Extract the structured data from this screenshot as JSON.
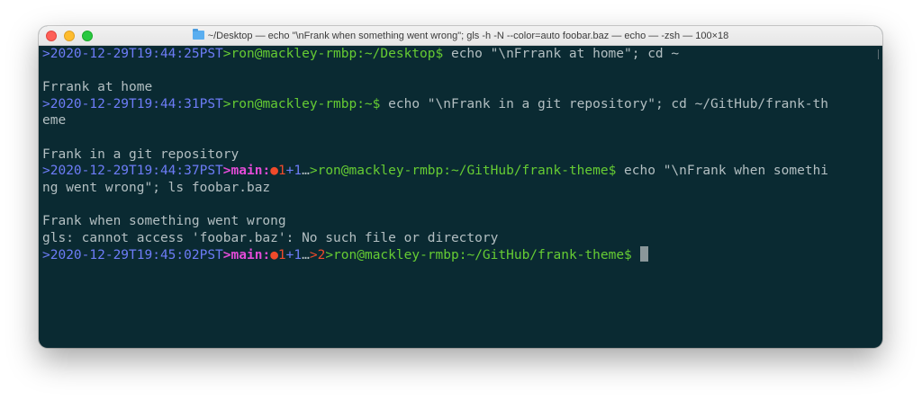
{
  "window": {
    "title": "~/Desktop — echo \"\\nFrank when something went wrong\"; gls -h -N --color=auto foobar.baz — echo — -zsh — 100×18"
  },
  "terminal": {
    "lines": [
      {
        "date": ">2020-12-29T19:44:25PST",
        "userhost": ">ron@mackley-rmbp:~/Desktop$",
        "command": " echo \"\\nFrrank at home\"; cd ~"
      },
      {
        "text": ""
      },
      {
        "text": "Frrank at home"
      },
      {
        "date": ">2020-12-29T19:44:31PST",
        "userhost": ">ron@mackley-rmbp:~$",
        "command": " echo \"\\nFrank in a git repository\"; cd ~/GitHub/frank-th"
      },
      {
        "text": "eme"
      },
      {
        "text": ""
      },
      {
        "text": "Frank in a git repository"
      },
      {
        "date": ">2020-12-29T19:44:37PST",
        "branch": ">main:",
        "status_dot": "●1",
        "status_plus": "+1",
        "ellipsis": "…",
        "userhost": ">ron@mackley-rmbp:~/GitHub/frank-theme$",
        "command": " echo \"\\nFrank when somethi"
      },
      {
        "text": "ng went wrong\"; ls foobar.baz"
      },
      {
        "text": ""
      },
      {
        "text": "Frank when something went wrong"
      },
      {
        "text": "gls: cannot access 'foobar.baz': No such file or directory"
      },
      {
        "date": ">2020-12-29T19:45:02PST",
        "branch": ">main:",
        "status_dot": "●1",
        "status_plus": "+1",
        "ellipsis": "…",
        "exit_code": ">2",
        "userhost": ">ron@mackley-rmbp:~/GitHub/frank-theme$",
        "command": " "
      }
    ]
  },
  "colors": {
    "background": "#0a2a32",
    "text": "#b3bfc2",
    "date": "#6d7cf7",
    "userhost": "#66cc33",
    "branch": "#e24bd6",
    "status": "#f04a2a"
  }
}
